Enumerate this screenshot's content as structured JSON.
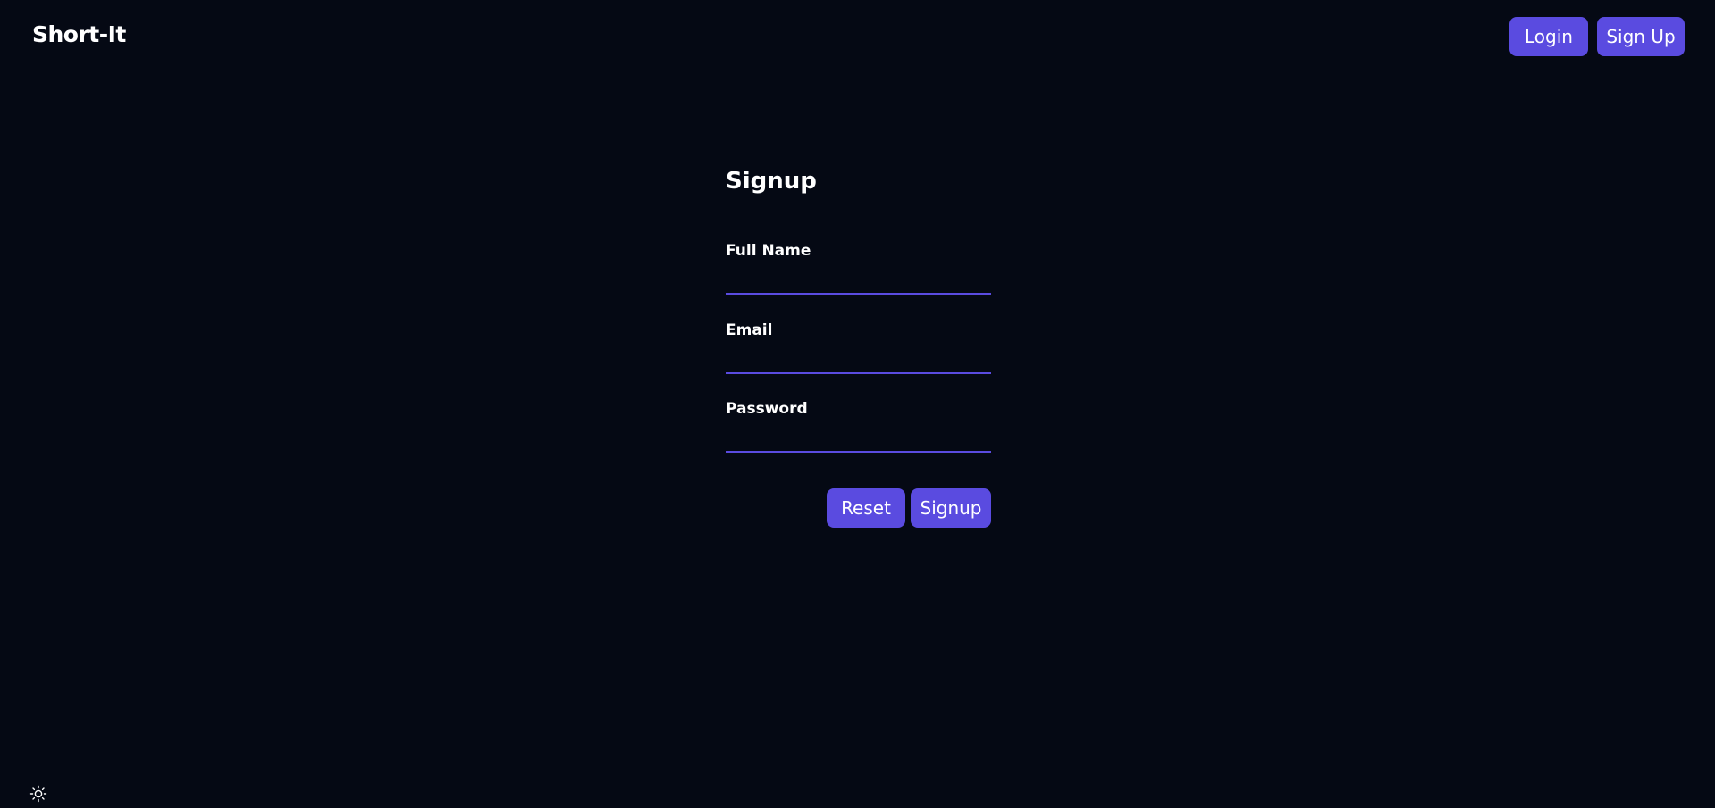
{
  "navbar": {
    "brand": "Short-It",
    "login_label": "Login",
    "signup_label": "Sign Up"
  },
  "form": {
    "title": "Signup",
    "fields": [
      {
        "label": "Full Name",
        "value": ""
      },
      {
        "label": "Email",
        "value": ""
      },
      {
        "label": "Password",
        "value": ""
      }
    ],
    "reset_label": "Reset",
    "submit_label": "Signup"
  },
  "theme_toggle": {
    "icon": "sun-icon"
  },
  "colors": {
    "background": "#050914",
    "accent": "#5a4be0",
    "text": "#ffffff"
  }
}
